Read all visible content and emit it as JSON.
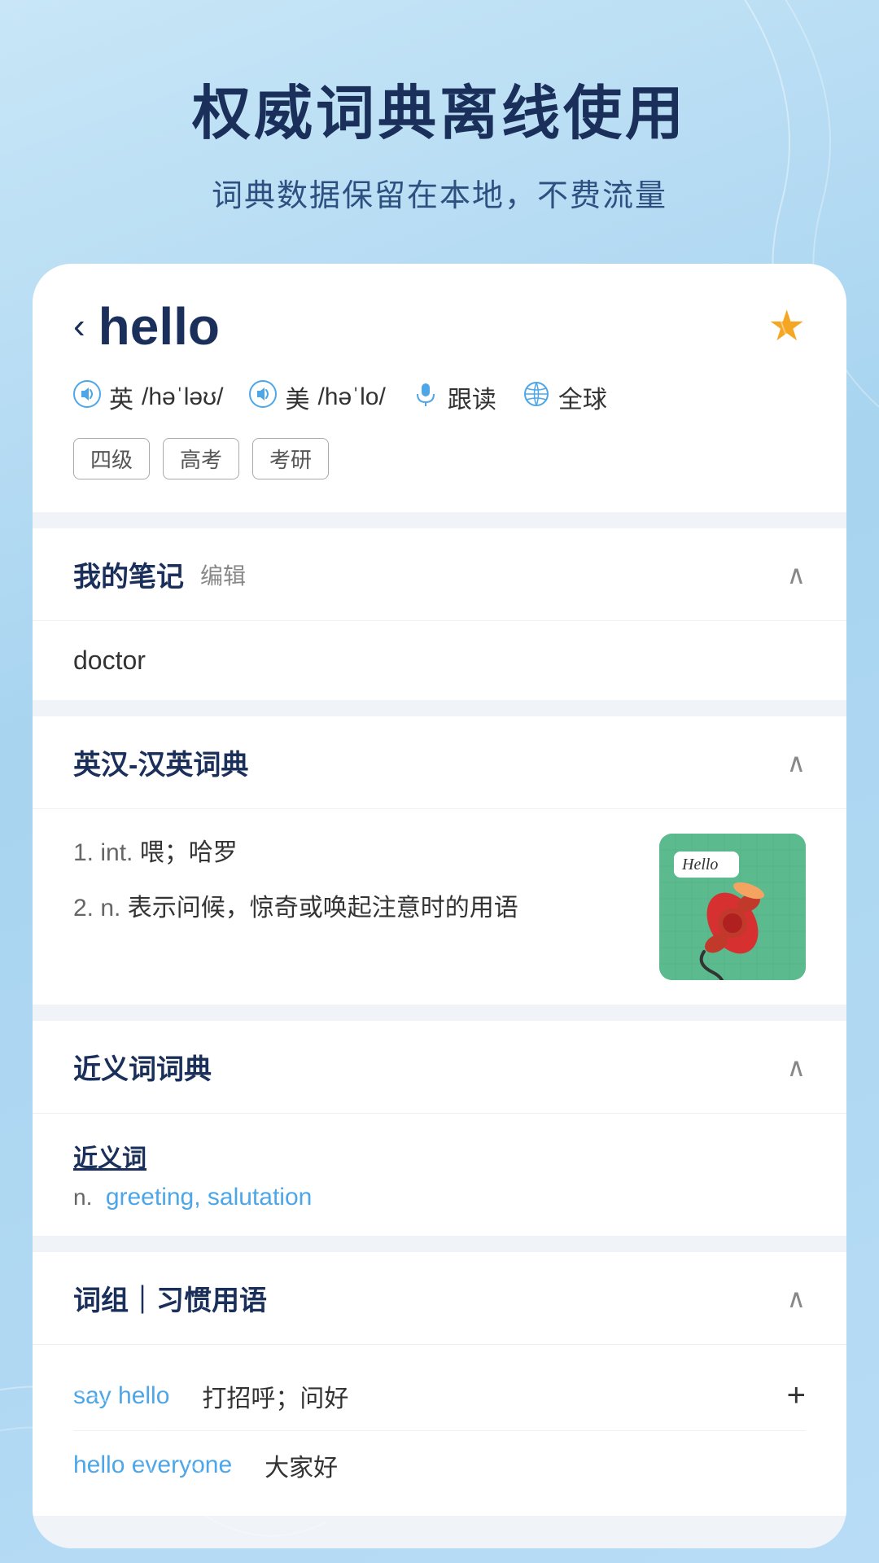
{
  "background": {
    "gradient_start": "#c8e6f7",
    "gradient_end": "#a8d4f0"
  },
  "hero": {
    "title": "权威词典离线使用",
    "subtitle": "词典数据保留在本地，不费流量"
  },
  "word_header": {
    "back_label": "‹",
    "word": "hello",
    "star_filled": true,
    "phonetics": [
      {
        "flag": "英",
        "ipa": "/həˈləʊ/",
        "icon": "speaker"
      },
      {
        "flag": "美",
        "ipa": "/həˈlo/",
        "icon": "speaker"
      }
    ],
    "follow_read_label": "跟读",
    "global_label": "全球",
    "tags": [
      "四级",
      "高考",
      "考研"
    ]
  },
  "my_notes": {
    "section_title": "我的笔记",
    "edit_label": "编辑",
    "note_text": "doctor"
  },
  "dictionary": {
    "section_title": "英汉-汉英词典",
    "definitions": [
      {
        "num": "1.",
        "pos": "int.",
        "text": "喂；哈罗"
      },
      {
        "num": "2.",
        "pos": "n.",
        "text": "表示问候，惊奇或唤起注意时的用语"
      }
    ],
    "image_alt": "Hello telephone illustration"
  },
  "synonyms": {
    "section_title": "近义词词典",
    "label": "近义词",
    "pos": "n.",
    "words": "greeting, salutation"
  },
  "phrases": {
    "section_title": "词组｜习惯用语",
    "items": [
      {
        "phrase": "say hello",
        "meaning": "打招呼；问好",
        "has_add": true
      },
      {
        "phrase": "hello everyone",
        "meaning": "大家好",
        "has_add": false
      }
    ]
  }
}
